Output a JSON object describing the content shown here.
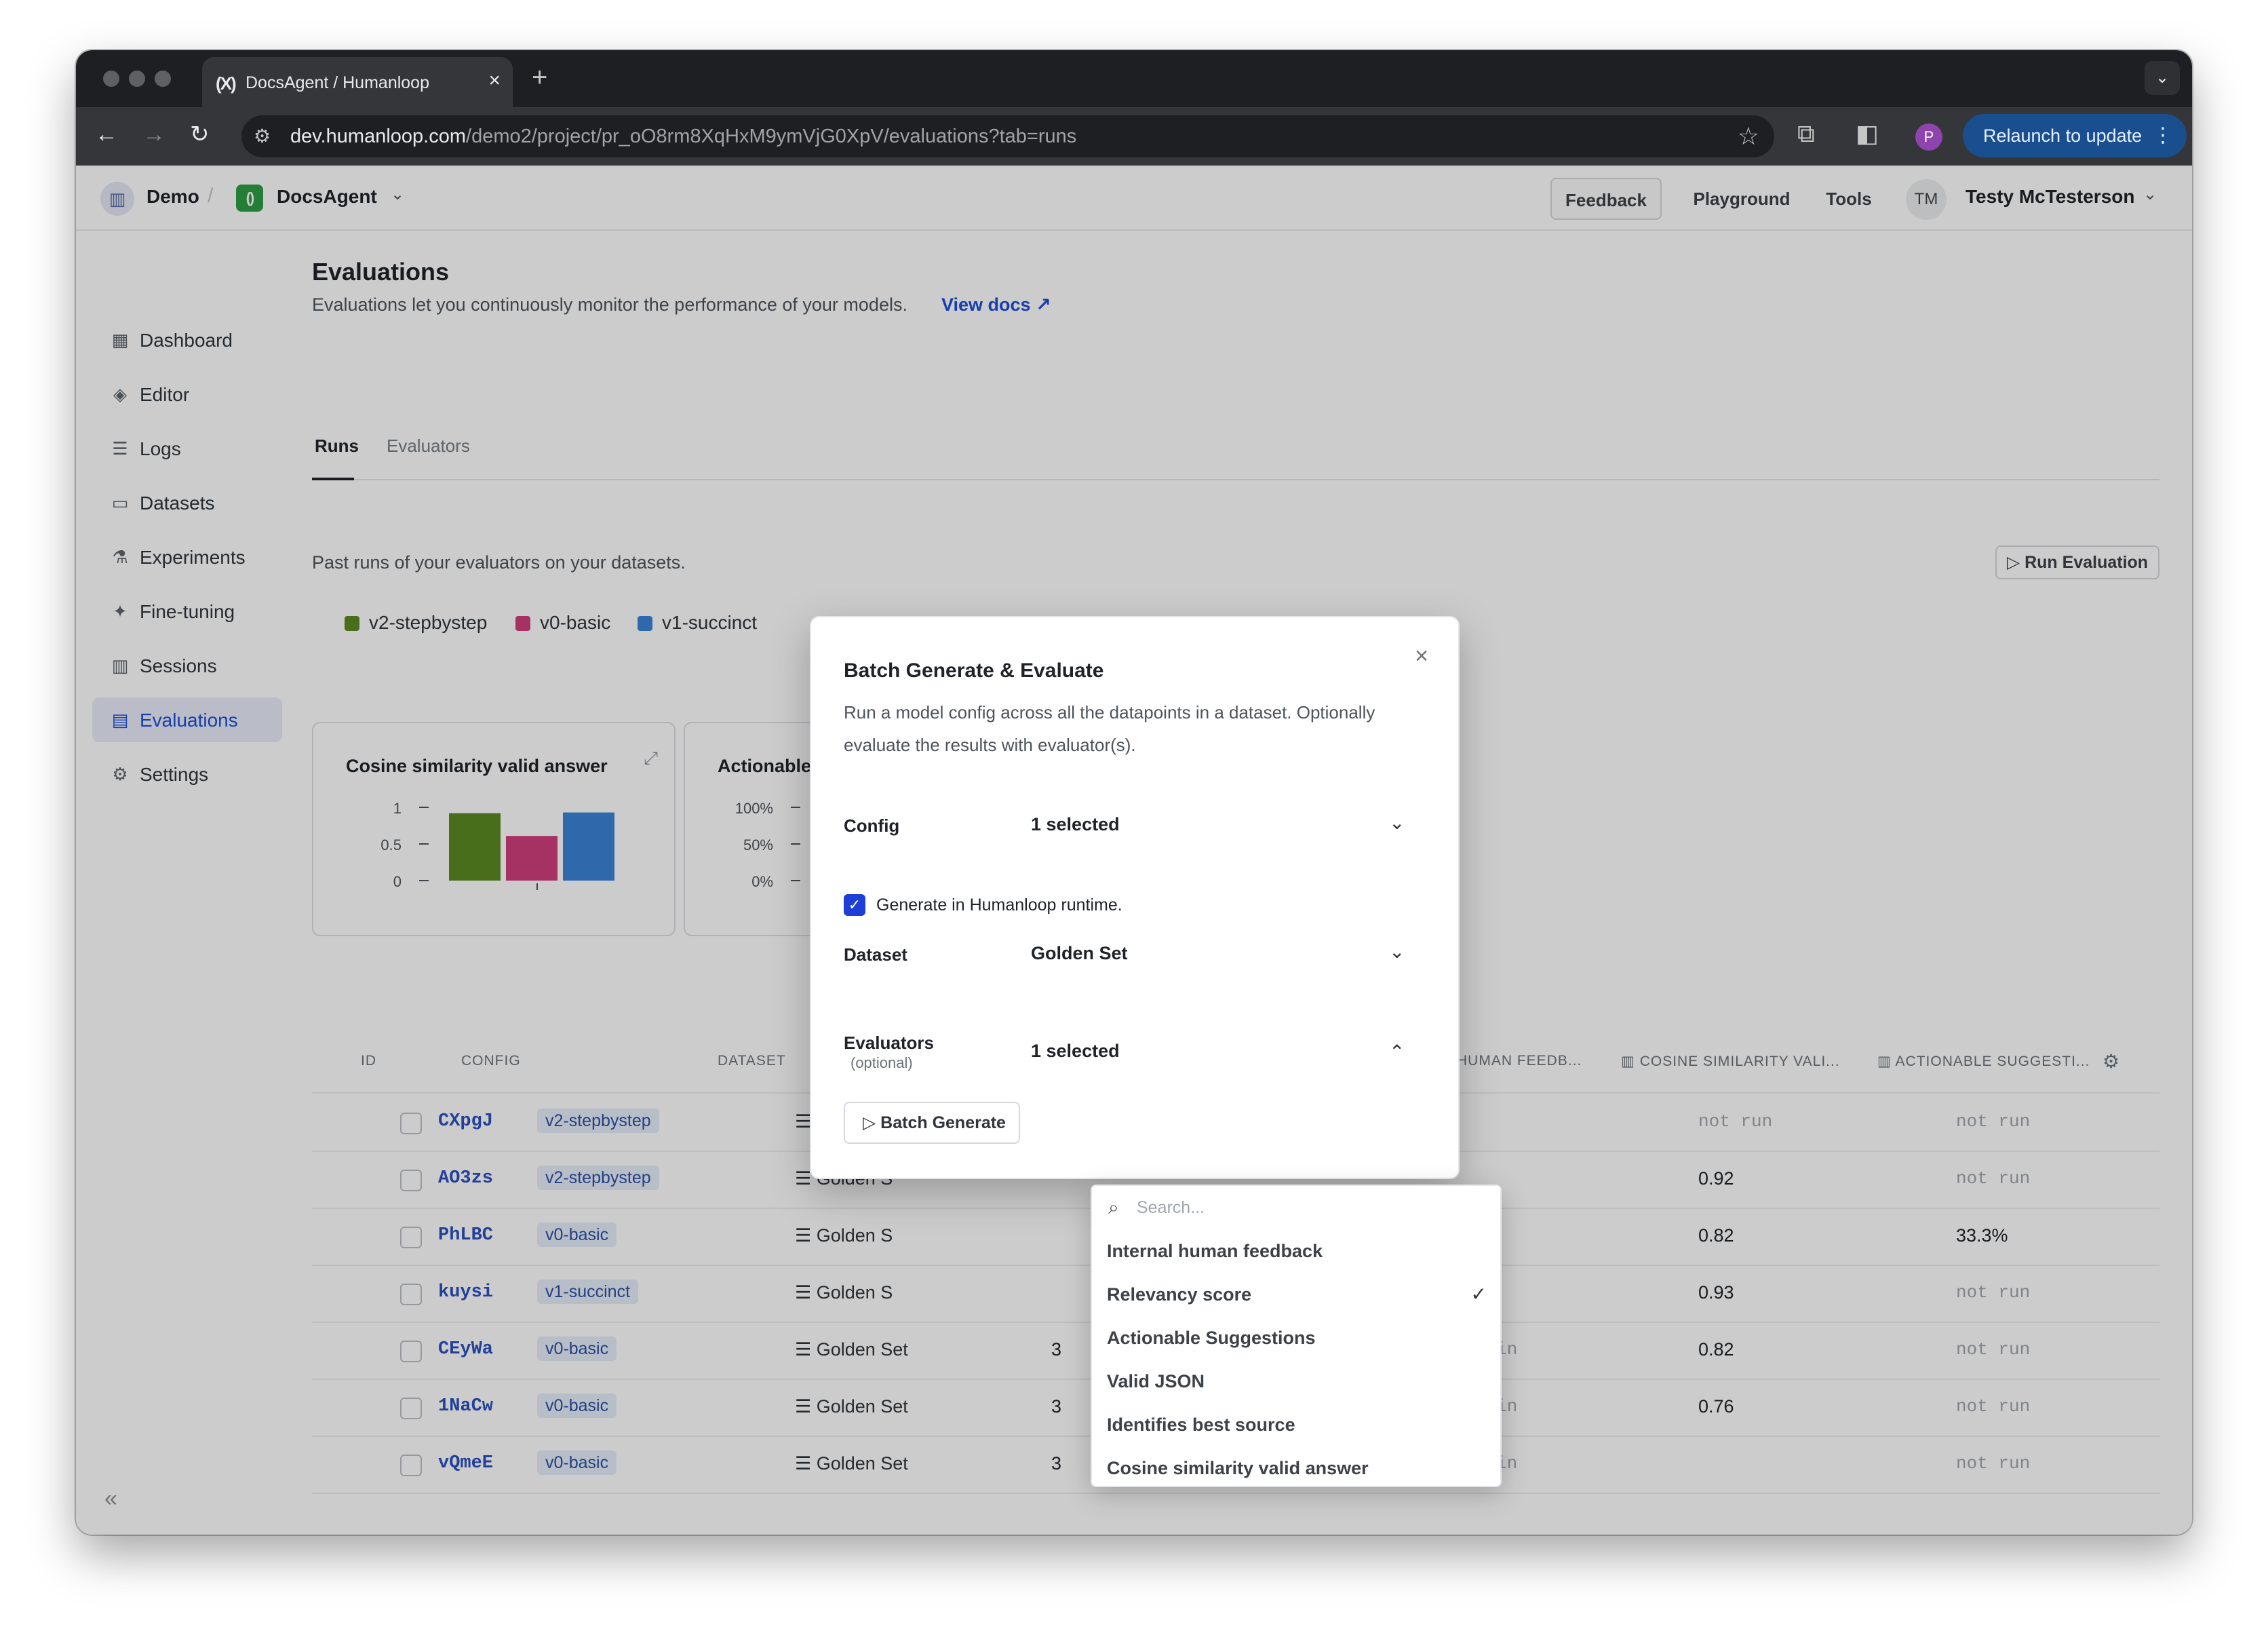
{
  "browser": {
    "tab_title": "DocsAgent / Humanloop",
    "tab_icon": "(X)",
    "url_host": "dev.humanloop.com",
    "url_path": "/demo2/project/pr_oO8rm8XqHxM9ymVjG0XpV/evaluations?tab=runs",
    "profile_initial": "P",
    "relaunch_label": "Relaunch to update"
  },
  "header": {
    "org": "Demo",
    "project": "DocsAgent",
    "feedback": "Feedback",
    "playground": "Playground",
    "tools": "Tools",
    "user_initials": "TM",
    "user_name": "Testy McTesterson"
  },
  "sidebar": {
    "items": [
      {
        "label": "Dashboard",
        "icon": "grid-icon"
      },
      {
        "label": "Editor",
        "icon": "diamond-icon"
      },
      {
        "label": "Logs",
        "icon": "database-icon"
      },
      {
        "label": "Datasets",
        "icon": "folder-icon"
      },
      {
        "label": "Experiments",
        "icon": "flask-icon"
      },
      {
        "label": "Fine-tuning",
        "icon": "sparkle-icon"
      },
      {
        "label": "Sessions",
        "icon": "columns-icon"
      },
      {
        "label": "Evaluations",
        "icon": "clipboard-icon"
      },
      {
        "label": "Settings",
        "icon": "gear-icon"
      }
    ],
    "active": "Evaluations",
    "collapse": "«"
  },
  "page": {
    "title": "Evaluations",
    "subtitle": "Evaluations let you continuously monitor the performance of your models.",
    "view_docs": "View docs",
    "tabs": [
      "Runs",
      "Evaluators"
    ],
    "runs_subtitle": "Past runs of your evaluators on your datasets.",
    "run_eval_button": "Run Evaluation"
  },
  "legend": [
    {
      "name": "v2-stepbystep",
      "color": "#5a8a24"
    },
    {
      "name": "v0-basic",
      "color": "#d03f7e"
    },
    {
      "name": "v1-succinct",
      "color": "#3b82d6"
    }
  ],
  "chart_data": [
    {
      "type": "bar",
      "title": "Cosine similarity valid answer",
      "categories": [
        ""
      ],
      "series": [
        {
          "name": "v2-stepbystep",
          "values": [
            0.92
          ],
          "color": "#5a8a24"
        },
        {
          "name": "v0-basic",
          "values": [
            0.61
          ],
          "color": "#d03f7e"
        },
        {
          "name": "v1-succinct",
          "values": [
            0.93
          ],
          "color": "#3b82d6"
        }
      ],
      "yticks": [
        "1",
        "0.5",
        "0"
      ],
      "ylim": [
        0,
        1
      ]
    },
    {
      "type": "bar",
      "title": "Actionable",
      "yticks": [
        "100%",
        "50%",
        "0%"
      ],
      "ylim": [
        0,
        100
      ]
    }
  ],
  "table": {
    "headers": [
      "ID",
      "CONFIG",
      "DATASET",
      "HUMAN FEEDB...",
      "COSINE SIMILARITY VALI...",
      "ACTIONABLE SUGGESTI..."
    ],
    "rows": [
      {
        "id": "CXpgJ",
        "config": "v2-stepbystep",
        "dataset": "Golden S",
        "count": "",
        "human": "",
        "cosine": "not run",
        "actionable": "not run"
      },
      {
        "id": "AO3zs",
        "config": "v2-stepbystep",
        "dataset": "Golden S",
        "count": "",
        "human": "",
        "cosine": "0.92",
        "actionable": "not run"
      },
      {
        "id": "PhLBC",
        "config": "v0-basic",
        "dataset": "Golden S",
        "count": "",
        "human": "",
        "cosine": "0.82",
        "actionable": "33.3%"
      },
      {
        "id": "kuysi",
        "config": "v1-succinct",
        "dataset": "Golden S",
        "count": "",
        "human": "",
        "cosine": "0.93",
        "actionable": "not run"
      },
      {
        "id": "CEyWa",
        "config": "v0-basic",
        "dataset": "Golden Set",
        "count": "3",
        "human": "in",
        "cosine": "0.82",
        "actionable": "not run"
      },
      {
        "id": "1NaCw",
        "config": "v0-basic",
        "dataset": "Golden Set",
        "count": "3",
        "human": "in",
        "cosine": "0.76",
        "actionable": "not run"
      },
      {
        "id": "vQmeE",
        "config": "v0-basic",
        "dataset": "Golden Set",
        "count": "3",
        "human": "in",
        "cosine": "",
        "actionable": "not run"
      }
    ]
  },
  "modal": {
    "title": "Batch Generate & Evaluate",
    "description": "Run a model config across all the datapoints in a dataset. Optionally evaluate the results with evaluator(s).",
    "config_label": "Config",
    "config_value": "1 selected",
    "runtime_label": "Generate in Humanloop runtime.",
    "dataset_label": "Dataset",
    "dataset_value": "Golden Set",
    "evaluators_label": "Evaluators",
    "evaluators_optional": "(optional)",
    "evaluators_value": "1 selected",
    "batch_button": "Batch Generate"
  },
  "dropdown": {
    "search_placeholder": "Search...",
    "items": [
      {
        "label": "Internal human feedback",
        "selected": false
      },
      {
        "label": "Relevancy score",
        "selected": true
      },
      {
        "label": "Actionable Suggestions",
        "selected": false
      },
      {
        "label": "Valid JSON",
        "selected": false
      },
      {
        "label": "Identifies best source",
        "selected": false
      },
      {
        "label": "Cosine similarity valid answer",
        "selected": false
      }
    ]
  }
}
